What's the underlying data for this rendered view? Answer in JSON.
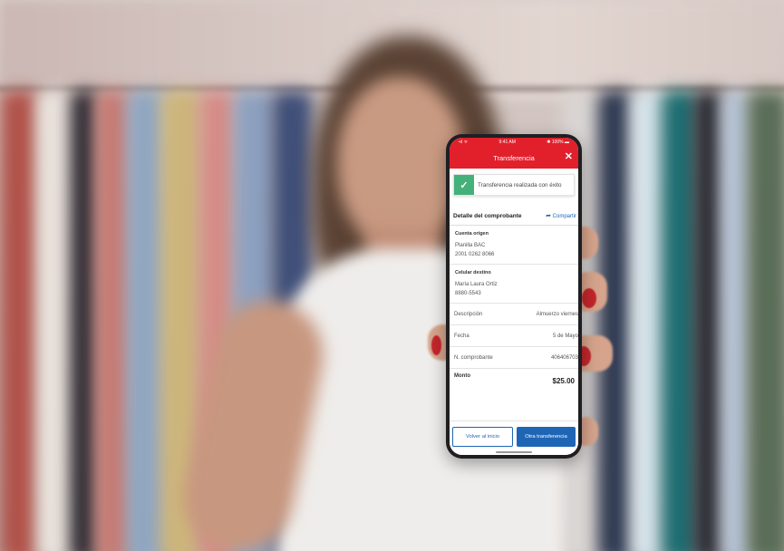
{
  "colors": {
    "brand_red": "#e2202c",
    "action_blue": "#1e66b5",
    "success_green": "#44b07a"
  },
  "status_bar": {
    "carrier": "•ıl ᯤ",
    "time": "9:41 AM",
    "battery": "✱ 100% ▬"
  },
  "header": {
    "title": "Transferencia",
    "close_icon": "close-icon",
    "close_glyph": "✕"
  },
  "success_banner": {
    "icon": "check-icon",
    "glyph": "✓",
    "text": "Transferencia realizada con éxito"
  },
  "detail": {
    "title": "Detalle del comprobante",
    "share_icon": "share-arrow-icon",
    "share_glyph": "➦",
    "share_label": "Compartir",
    "source_account": {
      "label": "Cuenta origen",
      "name": "Planilla BAC",
      "number": "2001 0262 8066"
    },
    "destination": {
      "label": "Celular destino",
      "name": "María Laura Ortiz",
      "number": "8880-5543"
    },
    "rows": [
      {
        "label": "Descripción",
        "value": "Almuerzo viernes"
      },
      {
        "label": "Fecha",
        "value": "5 de Mayo"
      },
      {
        "label": "N. comprobante",
        "value": "406406703"
      }
    ],
    "total": {
      "label": "Monto",
      "value": "$25.00"
    }
  },
  "actions": {
    "back_home": "Volver al inicio",
    "new_transfer": "Otra transferencia"
  }
}
